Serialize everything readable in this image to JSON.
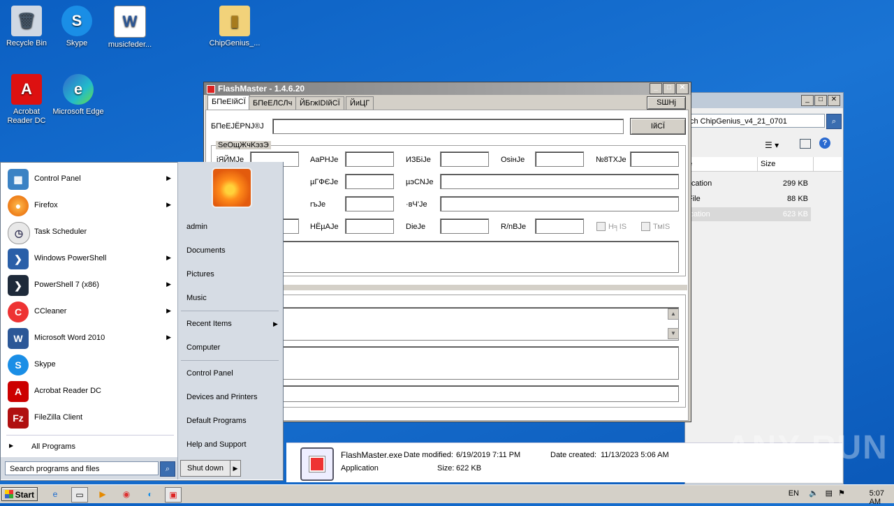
{
  "desktop": {
    "icons": [
      {
        "label": "Recycle Bin",
        "icon": "recycle-bin-icon"
      },
      {
        "label": "Skype",
        "icon": "skype-icon"
      },
      {
        "label": "musicfeder...",
        "icon": "word-document-icon"
      },
      {
        "label": "ChipGenius_...",
        "icon": "folder-zip-icon"
      },
      {
        "label": "Acrobat Reader DC",
        "icon": "acrobat-icon"
      },
      {
        "label": "Microsoft Edge",
        "icon": "edge-icon"
      }
    ]
  },
  "explorer": {
    "address": "ch ChipGenius_v4_21_0701",
    "columns": [
      "e",
      "Size"
    ],
    "rows": [
      {
        "type": "lication",
        "size": "299 KB"
      },
      {
        "type": "File",
        "size": "88 KB"
      },
      {
        "type": "ication",
        "size": "623 KB"
      }
    ],
    "details": {
      "name": "FlashMaster.exe",
      "modified_label": "Date modified:",
      "modified": "6/19/2019 7:11 PM",
      "created_label": "Date created:",
      "created": "11/13/2023 5:06 AM",
      "type": "Application",
      "size_label": "Size:",
      "size": "622 KB"
    }
  },
  "flashmaster": {
    "title": "FlashMaster - 1.4.6.20",
    "tabs": [
      "БПеЕІйСЇ",
      "БПеЕЛСЛч",
      "ЙБгжІDІйСЇ",
      "ЙиЦГ"
    ],
    "top_button": "SШНј",
    "drive_label": "БПеЕJЁРNJ®J",
    "drive_button": "ІйСЇ",
    "group_title": "SeОщЖчKэзЭ",
    "row1": [
      "іЯЙМJe",
      "AaPHJe",
      "ИЗБiJe",
      "OѕiнJe",
      "№8ТХJe"
    ],
    "row2": [
      "µГФЄJe",
      "µэСNJe"
    ],
    "row3": [
      "rъJe",
      "·вЧ'Je"
    ],
    "row4": [
      "НЁµAJe",
      "DieJe",
      "R/nBJe"
    ],
    "checks": [
      "Н╕IS",
      "ТмIS"
    ]
  },
  "start_menu": {
    "programs": [
      {
        "label": "Control Panel",
        "icon": "control-panel-icon",
        "arrow": true
      },
      {
        "label": "Firefox",
        "icon": "firefox-icon",
        "arrow": true
      },
      {
        "label": "Task Scheduler",
        "icon": "task-scheduler-icon",
        "arrow": false
      },
      {
        "label": "Windows PowerShell",
        "icon": "powershell-icon",
        "arrow": true
      },
      {
        "label": "PowerShell 7 (x86)",
        "icon": "powershell7-icon",
        "arrow": true
      },
      {
        "label": "CCleaner",
        "icon": "ccleaner-icon",
        "arrow": true
      },
      {
        "label": "Microsoft Word 2010",
        "icon": "word-icon",
        "arrow": true
      },
      {
        "label": "Skype",
        "icon": "skype-icon",
        "arrow": false
      },
      {
        "label": "Acrobat Reader DC",
        "icon": "acrobat-icon",
        "arrow": false
      },
      {
        "label": "FileZilla Client",
        "icon": "filezilla-icon",
        "arrow": false
      }
    ],
    "all_programs": "All Programs",
    "search_placeholder": "Search programs and files",
    "right": [
      "admin",
      "Documents",
      "Pictures",
      "Music",
      "Recent Items",
      "Computer",
      "Control Panel",
      "Devices and Printers",
      "Default Programs",
      "Help and Support"
    ],
    "shutdown": "Shut down"
  },
  "taskbar": {
    "start": "Start",
    "lang": "EN",
    "time": "5:07 AM"
  },
  "watermark": "ANY RUN"
}
